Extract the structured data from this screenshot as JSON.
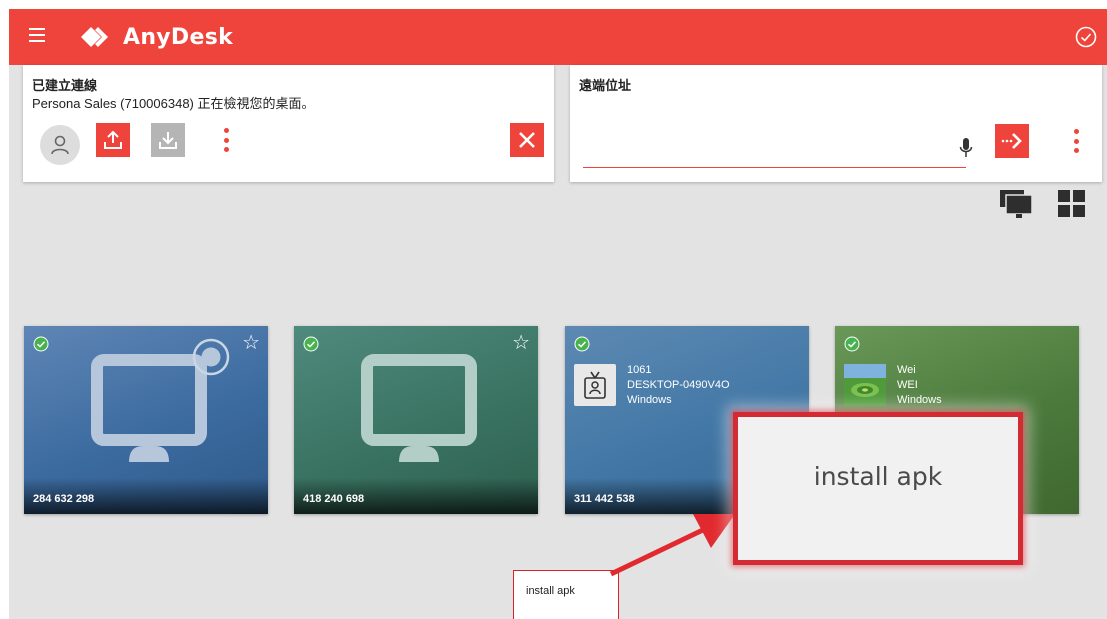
{
  "app": {
    "name": "AnyDesk",
    "colors": {
      "brand": "#ef443b",
      "background": "#e3e3e3",
      "callout_border": "#d32a34"
    }
  },
  "header": {
    "menu_icon": "hamburger-menu-icon",
    "status_icon": "check-circle-icon"
  },
  "connection_panel": {
    "title": "已建立連線",
    "message": "Persona Sales (710006348) 正在檢視您的桌面。",
    "buttons": [
      "user-icon",
      "upload-icon",
      "download-icon",
      "more-icon",
      "close-icon"
    ]
  },
  "remote_panel": {
    "title": "遠端位址",
    "address_value": "",
    "icons": [
      "mic-icon",
      "connect-arrow-icon",
      "more-icon"
    ]
  },
  "view_toggles": [
    "monitor-view-icon",
    "grid-view-icon"
  ],
  "cards": [
    {
      "id": "284 632 298",
      "online": true,
      "favorite": true
    },
    {
      "id": "418 240 698",
      "online": true,
      "favorite": true
    },
    {
      "id": "311 442 538",
      "online": true,
      "alias": "1061",
      "hostname": "DESKTOP-0490V4O",
      "os": "Windows"
    },
    {
      "alias": "Wei",
      "hostname": "WEI",
      "os": "Windows",
      "online": true
    }
  ],
  "callouts": {
    "tooltip": "install apk",
    "zoom": "install apk"
  }
}
